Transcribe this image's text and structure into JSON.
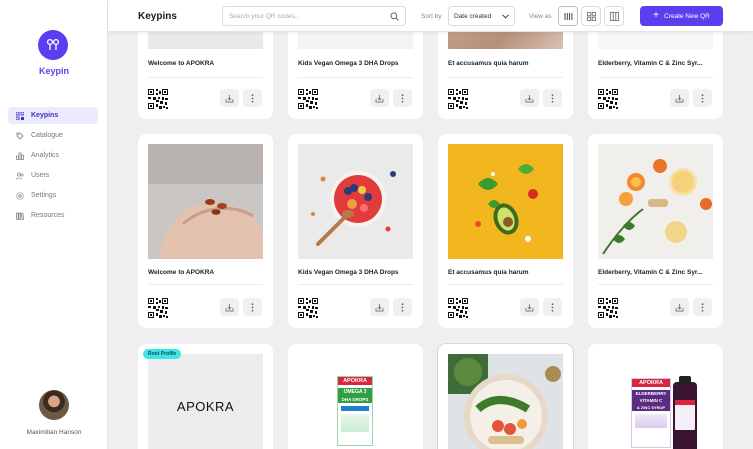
{
  "app": {
    "name": "Keypin"
  },
  "sidebar": {
    "items": [
      {
        "label": "Keypins",
        "icon": "qr-grid-icon",
        "active": true
      },
      {
        "label": "Catalogue",
        "icon": "tag-icon"
      },
      {
        "label": "Analytics",
        "icon": "bar-chart-icon"
      },
      {
        "label": "Users",
        "icon": "users-icon"
      },
      {
        "label": "Settings",
        "icon": "gear-icon"
      },
      {
        "label": "Resources",
        "icon": "library-icon"
      }
    ]
  },
  "user": {
    "name": "Maximilian Hanson"
  },
  "header": {
    "title": "Keypins",
    "search_placeholder": "Search your QR codes...",
    "sort_label": "Sort by",
    "sort_value": "Date created",
    "view_label": "View as",
    "create_label": "Create New QR"
  },
  "cards": [
    {
      "title": "Welcome to APOKRA"
    },
    {
      "title": "Kids Vegan Omega 3 DHA Drops"
    },
    {
      "title": "Et accusamus quia harum"
    },
    {
      "title": "Elderberry, Vitamin C & Zinc Syr..."
    },
    {
      "title": "Welcome to APOKRA"
    },
    {
      "title": "Kids Vegan Omega 3 DHA Drops"
    },
    {
      "title": "Et accusamus quia harum"
    },
    {
      "title": "Elderberry, Vitamin C & Zinc Syr..."
    },
    {
      "badge": "Root Profile",
      "logo": "APOKRA"
    },
    {
      "product_brand": "APOKRA",
      "product_line1": "OMEGA 3",
      "product_line2": "DHA DROPS"
    },
    {},
    {
      "product_brand": "APOKRA",
      "product_line1": "ELDERBERRY",
      "product_line2": "VITAMIN C",
      "product_line3": "& ZINC SYRUP"
    }
  ],
  "colors": {
    "accent": "#5a3ff0",
    "badge": "#3ee6e6",
    "background": "#efeff1"
  }
}
